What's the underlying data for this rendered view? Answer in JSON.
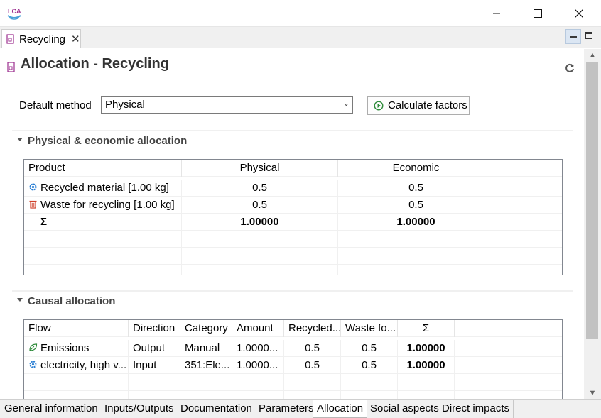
{
  "window": {
    "app_logo_text": "LCA",
    "tab_title": "Recycling"
  },
  "page": {
    "title": "Allocation - Recycling"
  },
  "method": {
    "label": "Default method",
    "selected": "Physical",
    "calculate_label": "Calculate factors"
  },
  "physical_section": {
    "title": "Physical & economic allocation",
    "columns": [
      "Product",
      "Physical",
      "Economic",
      ""
    ],
    "rows": [
      {
        "icon": "gear-icon",
        "product": "Recycled material [1.00 kg]",
        "physical": "0.5",
        "economic": "0.5"
      },
      {
        "icon": "trash-icon",
        "product": "Waste for recycling [1.00 kg]",
        "physical": "0.5",
        "economic": "0.5"
      }
    ],
    "sum_row": {
      "label": "Σ",
      "physical": "1.00000",
      "economic": "1.00000"
    }
  },
  "causal_section": {
    "title": "Causal allocation",
    "columns": [
      "Flow",
      "Direction",
      "Category",
      "Amount",
      "Recycled...",
      "Waste fo...",
      "Σ",
      ""
    ],
    "rows": [
      {
        "icon": "leaf-icon",
        "flow": "Emissions",
        "direction": "Output",
        "category": "Manual",
        "amount": "1.0000...",
        "recycled": "0.5",
        "waste": "0.5",
        "sum": "1.00000"
      },
      {
        "icon": "gear-icon",
        "flow": "electricity, high v...",
        "direction": "Input",
        "category": "351:Ele...",
        "amount": "1.0000...",
        "recycled": "0.5",
        "waste": "0.5",
        "sum": "1.00000"
      }
    ]
  },
  "bottom_tabs": [
    "General information",
    "Inputs/Outputs",
    "Documentation",
    "Parameters",
    "Allocation",
    "Social aspects",
    "Direct impacts"
  ],
  "active_tab": "Allocation",
  "colors": {
    "accent_purple": "#9b2d8e",
    "icon_blue": "#2a7fd4",
    "icon_red": "#d0402a",
    "icon_green": "#2e8b3a"
  }
}
